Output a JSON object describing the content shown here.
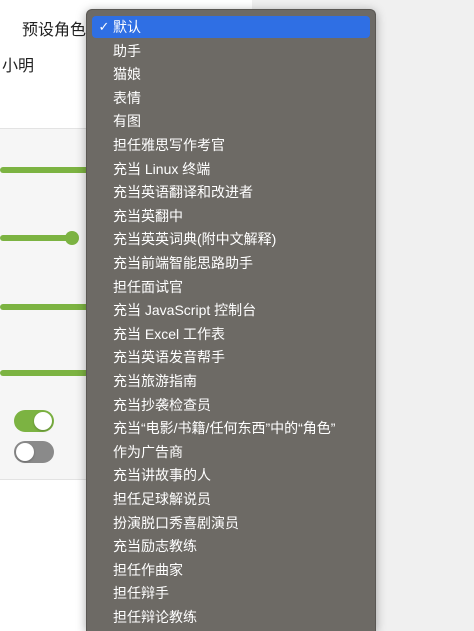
{
  "form": {
    "preset_label": "预设角色",
    "name_value": "小明"
  },
  "settings": {
    "sliders": [
      {
        "name": "slider-1",
        "value_fraction": 0.98
      },
      {
        "name": "slider-2",
        "value_fraction": 0.28
      },
      {
        "name": "slider-3",
        "value_fraction": 0.98
      },
      {
        "name": "slider-4",
        "value_fraction": 0.98
      }
    ],
    "toggles": [
      {
        "name": "toggle-1",
        "on": true
      },
      {
        "name": "toggle-2",
        "on": false
      }
    ],
    "accent_color": "#7cb342"
  },
  "dropdown": {
    "selected_index": 0,
    "check_icon": "✓",
    "items": [
      "默认",
      "助手",
      "猫娘",
      "表情",
      "有图",
      "担任雅思写作考官",
      "充当 Linux 终端",
      "充当英语翻译和改进者",
      "充当英翻中",
      "充当英英词典(附中文解释)",
      "充当前端智能思路助手",
      "担任面试官",
      "充当 JavaScript 控制台",
      "充当 Excel 工作表",
      "充当英语发音帮手",
      "充当旅游指南",
      "充当抄袭检查员",
      "充当“电影/书籍/任何东西”中的“角色”",
      "作为广告商",
      "充当讲故事的人",
      "担任足球解说员",
      "扮演脱口秀喜剧演员",
      "充当励志教练",
      "担任作曲家",
      "担任辩手",
      "担任辩论教练"
    ],
    "selected_color": "#2f6fe4",
    "menu_bg": "#6d6a65"
  }
}
